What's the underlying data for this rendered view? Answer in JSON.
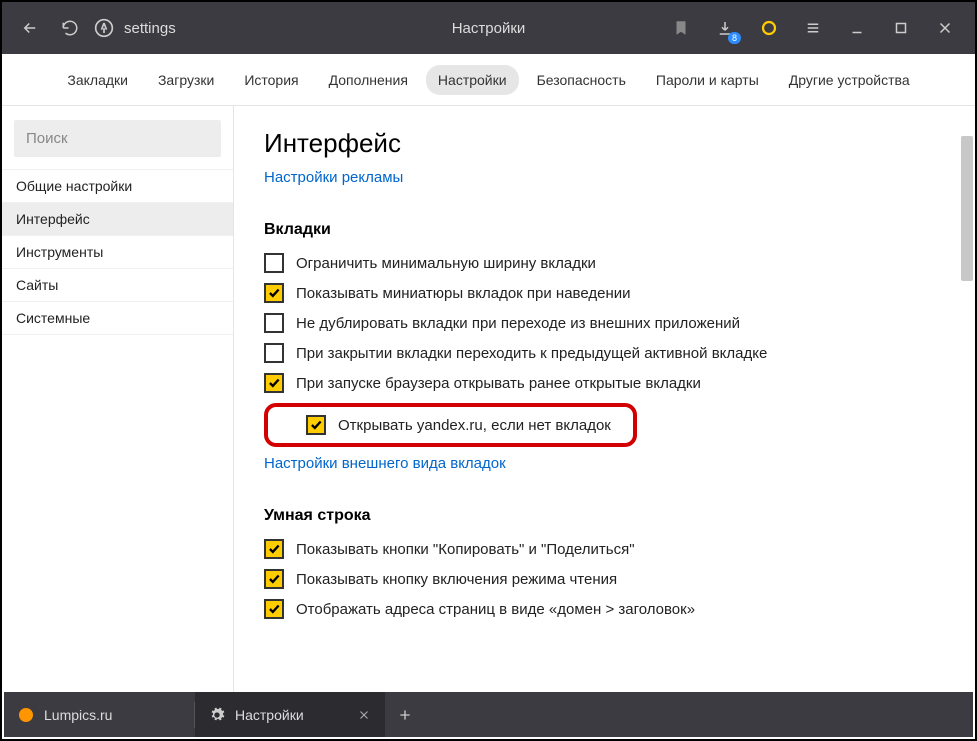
{
  "titlebar": {
    "address": "settings",
    "page_title": "Настройки",
    "download_badge": "8"
  },
  "topnav": {
    "items": [
      "Закладки",
      "Загрузки",
      "История",
      "Дополнения",
      "Настройки",
      "Безопасность",
      "Пароли и карты",
      "Другие устройства"
    ],
    "active_index": 4
  },
  "sidebar": {
    "search_placeholder": "Поиск",
    "items": [
      "Общие настройки",
      "Интерфейс",
      "Инструменты",
      "Сайты",
      "Системные"
    ],
    "selected_index": 1
  },
  "content": {
    "heading": "Интерфейс",
    "ads_link": "Настройки рекламы",
    "tabs_section": {
      "title": "Вкладки",
      "items": [
        {
          "checked": false,
          "label": "Ограничить минимальную ширину вкладки"
        },
        {
          "checked": true,
          "label": "Показывать миниатюры вкладок при наведении"
        },
        {
          "checked": false,
          "label": "Не дублировать вкладки при переходе из внешних приложений"
        },
        {
          "checked": false,
          "label": "При закрытии вкладки переходить к предыдущей активной вкладке"
        },
        {
          "checked": true,
          "label": "При запуске браузера открывать ранее открытые вкладки"
        },
        {
          "checked": true,
          "label": "Открывать yandex.ru, если нет вкладок",
          "indent": true,
          "highlighted": true
        }
      ],
      "appearance_link": "Настройки внешнего вида вкладок"
    },
    "smartline_section": {
      "title": "Умная строка",
      "items": [
        {
          "checked": true,
          "label": "Показывать кнопки \"Копировать\" и \"Поделиться\""
        },
        {
          "checked": true,
          "label": "Показывать кнопку включения режима чтения"
        },
        {
          "checked": true,
          "label": "Отображать адреса страниц в виде «домен > заголовок»"
        }
      ]
    }
  },
  "tabbar": {
    "tabs": [
      {
        "label": "Lumpics.ru",
        "active": false
      },
      {
        "label": "Настройки",
        "active": true
      }
    ]
  }
}
